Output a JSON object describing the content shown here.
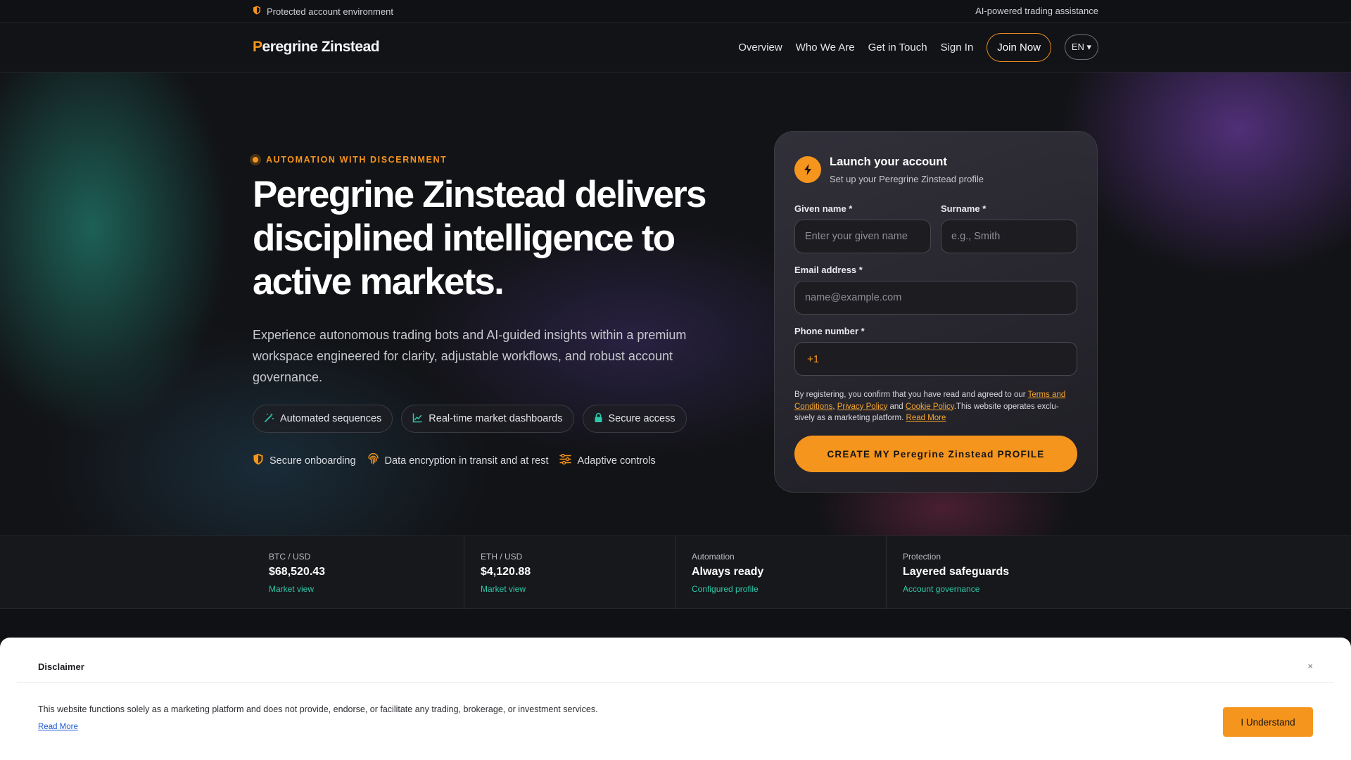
{
  "topbar": {
    "left_text": "Protected account environment",
    "right_text": "AI-powered trading assistance"
  },
  "header": {
    "logo_first_letter": "P",
    "logo_rest": "eregrine Zinstead",
    "nav": [
      "Overview",
      "Who We Are",
      "Get in Touch",
      "Sign In"
    ],
    "join_label": "Join Now",
    "lang_label": "EN ▾"
  },
  "hero": {
    "eyebrow": "AUTOMATION WITH DISCERNMENT",
    "headline": "Peregrine Zinstead delivers disciplined intelligence to active markets.",
    "lead": "Experience autonomous trading bots and AI-guided insights within a premium workspace engineered for clarity, adjustable workflows, and robust account governance.",
    "chips": [
      "Automated sequences",
      "Real-time market dashboards",
      "Secure access"
    ],
    "features": [
      "Secure onboarding",
      "Data encryption in transit and at rest",
      "Adaptive controls"
    ]
  },
  "signup": {
    "title": "Launch your account",
    "subtitle": "Set up your Peregrine Zinstead profile",
    "given_label": "Given name *",
    "given_placeholder": "Enter your given name",
    "surname_label": "Surname *",
    "surname_placeholder": "e.g., Smith",
    "email_label": "Email address *",
    "email_placeholder": "name@example.com",
    "phone_label": "Phone number *",
    "phone_prefix": "+1",
    "terms_pre": "By registering, you confirm that you have read and agreed to our ",
    "terms_link": "Terms and Conditions",
    "terms_sep": ", ",
    "privacy_link": "Privacy Policy",
    "terms_and": " and ",
    "cookie_link": "Cookie Policy",
    "terms_post": ".This website operates exclu-sively as a marketing platform. ",
    "read_more": "Read More",
    "cta": "CREATE MY Peregrine Zinstead PROFILE"
  },
  "stats": [
    {
      "key": "BTC / USD",
      "value": "$68,520.43",
      "link": "Market view"
    },
    {
      "key": "ETH / USD",
      "value": "$4,120.88",
      "link": "Market view"
    },
    {
      "key": "Automation",
      "value": "Always ready",
      "link": "Configured profile"
    },
    {
      "key": "Protection",
      "value": "Layered safeguards",
      "link": "Account governance"
    }
  ],
  "disclaimer": {
    "title": "Disclaimer",
    "close": "×",
    "text": "This website functions solely as a marketing platform and does not provide, endorse, or facilitate any trading, brokerage, or investment services.",
    "read_more": "Read More",
    "button": "I Understand"
  },
  "colors": {
    "accent": "#f6951d",
    "teal": "#2ec7a8",
    "background": "#121316"
  }
}
